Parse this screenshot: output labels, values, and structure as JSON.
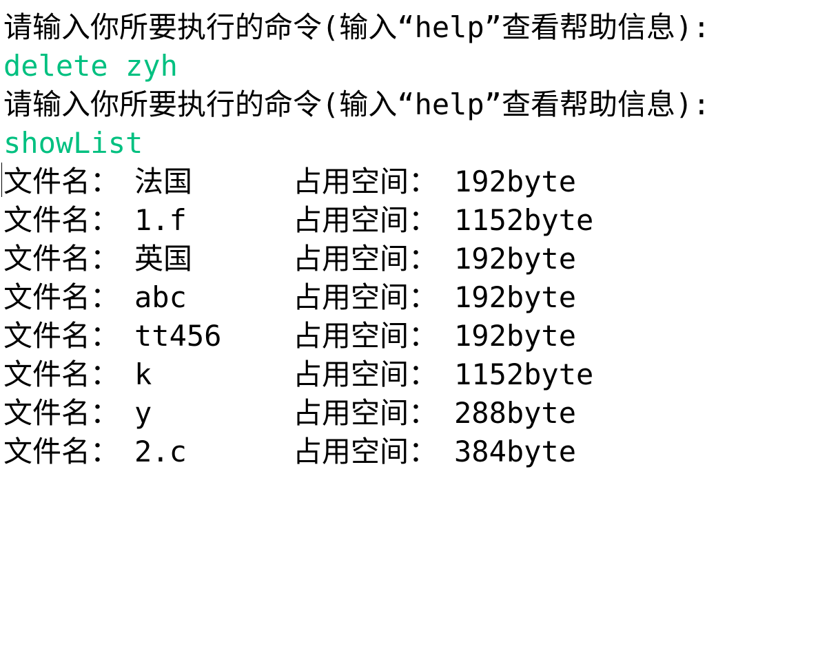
{
  "console": {
    "prompt1": "请输入你所要执行的命令(输入“help”查看帮助信息):",
    "command1": "delete zyh",
    "prompt2": "请输入你所要执行的命令(输入“help”查看帮助信息):",
    "command2": "showList",
    "files": [
      {
        "name_label": "文件名：",
        "name": "法国",
        "size_label": "占用空间：",
        "size": "192byte"
      },
      {
        "name_label": "文件名：",
        "name": "1.f",
        "size_label": "占用空间：",
        "size": "1152byte"
      },
      {
        "name_label": "文件名：",
        "name": "英国",
        "size_label": "占用空间：",
        "size": "192byte"
      },
      {
        "name_label": "文件名：",
        "name": "abc",
        "size_label": "占用空间：",
        "size": "192byte"
      },
      {
        "name_label": "文件名：",
        "name": "tt456",
        "size_label": "占用空间：",
        "size": "192byte"
      },
      {
        "name_label": "文件名：",
        "name": "k",
        "size_label": "占用空间：",
        "size": "1152byte"
      },
      {
        "name_label": "文件名：",
        "name": "y",
        "size_label": "占用空间：",
        "size": "288byte"
      },
      {
        "name_label": "文件名：",
        "name": "2.c",
        "size_label": "占用空间：",
        "size": "384byte"
      }
    ]
  },
  "colors": {
    "background": "#ffffff",
    "text": "#000000",
    "command": "#00c080"
  }
}
